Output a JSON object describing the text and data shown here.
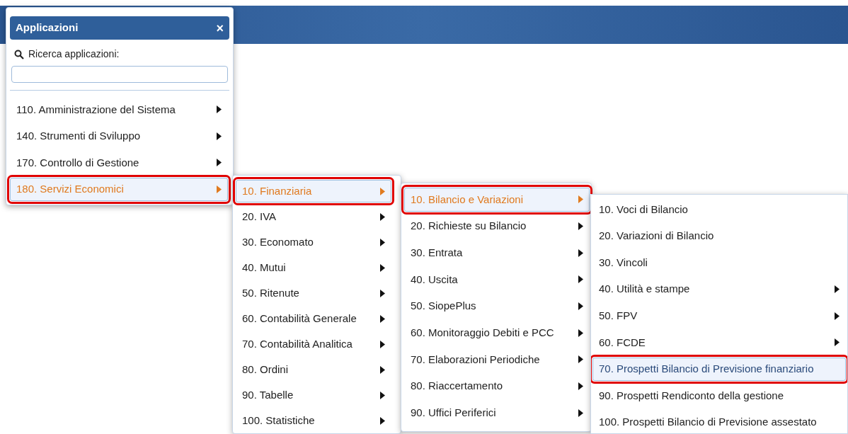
{
  "app_panel": {
    "title": "Applicazioni",
    "close": "×",
    "search_label": "Ricerca applicazioni:"
  },
  "menus": [
    {
      "items": [
        {
          "label": "110. Amministrazione del Sistema",
          "has_submenu": true,
          "selected": false,
          "open": false,
          "annotated": false
        },
        {
          "label": "140. Strumenti di Sviluppo",
          "has_submenu": true,
          "selected": false,
          "open": false,
          "annotated": false
        },
        {
          "label": "170. Controllo di Gestione",
          "has_submenu": true,
          "selected": false,
          "open": false,
          "annotated": false
        },
        {
          "label": "180. Servizi Economici",
          "has_submenu": true,
          "selected": true,
          "open": true,
          "annotated": true
        }
      ]
    },
    {
      "items": [
        {
          "label": "10. Finanziaria",
          "has_submenu": true,
          "selected": true,
          "open": true,
          "annotated": true
        },
        {
          "label": "20. IVA",
          "has_submenu": true,
          "selected": false,
          "open": false,
          "annotated": false
        },
        {
          "label": "30. Economato",
          "has_submenu": true,
          "selected": false,
          "open": false,
          "annotated": false
        },
        {
          "label": "40. Mutui",
          "has_submenu": true,
          "selected": false,
          "open": false,
          "annotated": false
        },
        {
          "label": "50. Ritenute",
          "has_submenu": true,
          "selected": false,
          "open": false,
          "annotated": false
        },
        {
          "label": "60. Contabilità Generale",
          "has_submenu": true,
          "selected": false,
          "open": false,
          "annotated": false
        },
        {
          "label": "70. Contabilità Analitica",
          "has_submenu": true,
          "selected": false,
          "open": false,
          "annotated": false
        },
        {
          "label": "80. Ordini",
          "has_submenu": true,
          "selected": false,
          "open": false,
          "annotated": false
        },
        {
          "label": "90. Tabelle",
          "has_submenu": true,
          "selected": false,
          "open": false,
          "annotated": false
        },
        {
          "label": "100. Statistiche",
          "has_submenu": true,
          "selected": false,
          "open": false,
          "annotated": false
        }
      ]
    },
    {
      "items": [
        {
          "label": "10. Bilancio e Variazioni",
          "has_submenu": true,
          "selected": true,
          "open": true,
          "annotated": true
        },
        {
          "label": "20. Richieste su Bilancio",
          "has_submenu": true,
          "selected": false,
          "open": false,
          "annotated": false
        },
        {
          "label": "30. Entrata",
          "has_submenu": true,
          "selected": false,
          "open": false,
          "annotated": false
        },
        {
          "label": "40. Uscita",
          "has_submenu": true,
          "selected": false,
          "open": false,
          "annotated": false
        },
        {
          "label": "50. SiopePlus",
          "has_submenu": true,
          "selected": false,
          "open": false,
          "annotated": false
        },
        {
          "label": "60. Monitoraggio Debiti e PCC",
          "has_submenu": true,
          "selected": false,
          "open": false,
          "annotated": false
        },
        {
          "label": "70. Elaborazioni Periodiche",
          "has_submenu": true,
          "selected": false,
          "open": false,
          "annotated": false
        },
        {
          "label": "80. Riaccertamento",
          "has_submenu": true,
          "selected": false,
          "open": false,
          "annotated": false
        },
        {
          "label": "90. Uffici Periferici",
          "has_submenu": true,
          "selected": false,
          "open": false,
          "annotated": false
        }
      ]
    },
    {
      "items": [
        {
          "label": "10. Voci di Bilancio",
          "has_submenu": false,
          "selected": false,
          "open": false,
          "annotated": false
        },
        {
          "label": "20. Variazioni di Bilancio",
          "has_submenu": false,
          "selected": false,
          "open": false,
          "annotated": false
        },
        {
          "label": "30. Vincoli",
          "has_submenu": false,
          "selected": false,
          "open": false,
          "annotated": false
        },
        {
          "label": "40. Utilità e stampe",
          "has_submenu": true,
          "selected": false,
          "open": false,
          "annotated": false
        },
        {
          "label": "50. FPV",
          "has_submenu": true,
          "selected": false,
          "open": false,
          "annotated": false
        },
        {
          "label": "60. FCDE",
          "has_submenu": true,
          "selected": false,
          "open": false,
          "annotated": false
        },
        {
          "label": "70. Prospetti Bilancio di Previsione finanziario",
          "has_submenu": false,
          "selected": true,
          "open": false,
          "annotated": true
        },
        {
          "label": "90. Prospetti Rendiconto della gestione",
          "has_submenu": false,
          "selected": false,
          "open": false,
          "annotated": false
        },
        {
          "label": "100. Prospetti Bilancio di Previsione assestato",
          "has_submenu": false,
          "selected": false,
          "open": false,
          "annotated": false
        }
      ]
    }
  ]
}
